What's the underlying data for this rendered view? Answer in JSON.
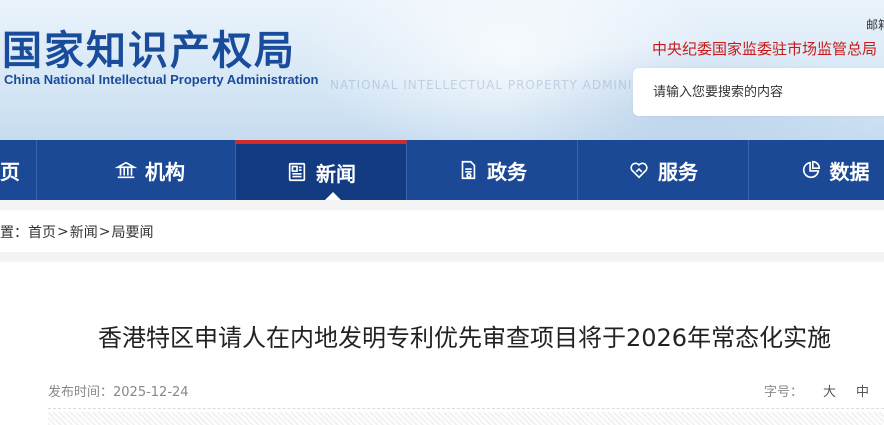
{
  "header": {
    "logo_cn": "国家知识产权局",
    "logo_en": "China National Intellectual Property Administration",
    "faint_caption": "NATIONAL INTELLECTUAL PROPERTY ADMINISTRATION",
    "mail_link": "邮箱",
    "supervise_link": "中央纪委国家监委驻市场监管总局",
    "search_placeholder": "请输入您要搜索的内容"
  },
  "nav": {
    "items": [
      {
        "label": "页",
        "icon": "none"
      },
      {
        "label": "机构",
        "icon": "institution-icon"
      },
      {
        "label": "新闻",
        "icon": "news-icon",
        "active": true
      },
      {
        "label": "政务",
        "icon": "document-icon"
      },
      {
        "label": "服务",
        "icon": "heart-hand-icon"
      },
      {
        "label": "数据",
        "icon": "pie-chart-icon"
      }
    ]
  },
  "breadcrumb": {
    "prefix": "置：",
    "items": [
      "首页",
      "新闻",
      "局要闻"
    ],
    "separator": ">"
  },
  "article": {
    "title": "香港特区申请人在内地发明专利优先审查项目将于2026年常态化实施",
    "publish_label": "发布时间：",
    "publish_date": "2025-12-24",
    "font_size_label": "字号：",
    "font_size_options": [
      "大",
      "中"
    ]
  },
  "colors": {
    "brand_blue": "#1c4995",
    "nav_active": "#133b82",
    "accent_red": "#d12a2a",
    "logo_blue": "#1a4c9c"
  }
}
